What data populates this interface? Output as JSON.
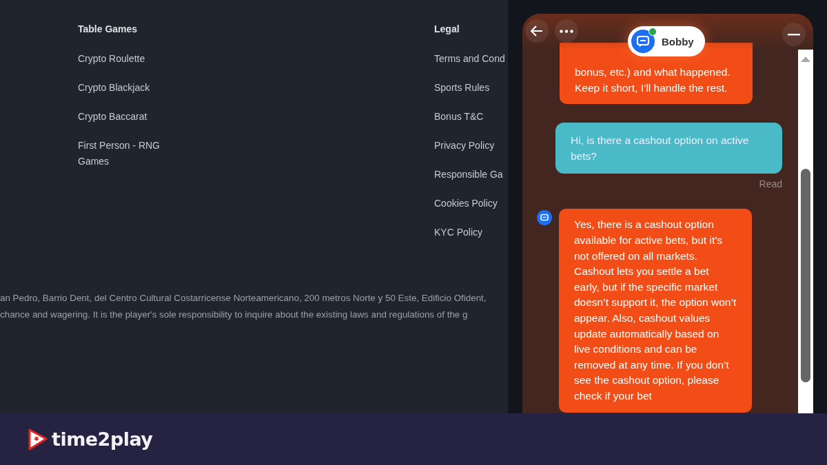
{
  "footer": {
    "columns": [
      {
        "heading": "Table Games",
        "links": [
          "Crypto Roulette",
          "Crypto Blackjack",
          "Crypto Baccarat",
          "First Person - RNG Games"
        ]
      },
      {
        "heading": "Legal",
        "links": [
          "Terms and Cond",
          "Sports Rules",
          "Bonus T&C",
          "Privacy Policy",
          "Responsible Ga",
          "Cookies Policy",
          "KYC Policy"
        ]
      }
    ],
    "legal_lines": [
      "an Pedro, Barrio Dent, del Centro Cultural Costarricense Norteamericano, 200 metros Norte y 50 Este, Edificio Ofident,",
      "chance and wagering. It is the player's sole responsibility to inquire about the existing laws and regulations of the g"
    ]
  },
  "chat": {
    "agent": {
      "name": "Bobby",
      "online": true
    },
    "messages": [
      {
        "kind": "bot",
        "text": "bonus, etc.) and what happened. Keep it short, I’ll handle the rest.",
        "avatar": false
      },
      {
        "kind": "user",
        "text": "Hi, is there a cashout option on active bets?",
        "status": "Read"
      },
      {
        "kind": "bot",
        "text": "Yes, there is a cashout option available for active bets, but it’s not offered on all markets. Cashout lets you settle a bet early, but if the specific market doesn’t support it, the option won’t appear. Also, cashout values update automatically based on live conditions and can be removed at any time. If you don’t see the cashout option, please check if your bet",
        "avatar": true
      }
    ]
  },
  "brand": {
    "name": "time2play"
  }
}
